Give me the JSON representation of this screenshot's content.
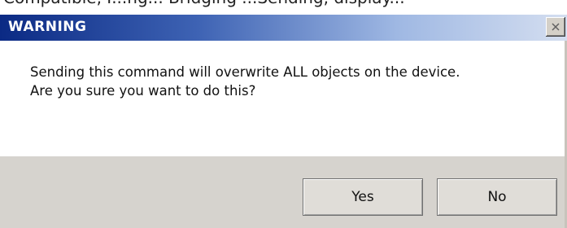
{
  "background_caption": "Compatible, I...ng... Bridging ...Sending, display...",
  "dialog": {
    "title": "WARNING",
    "close_label": "",
    "message_line_1": "Sending this command will overwrite ALL objects on the device.",
    "message_line_2": "Are you sure you want to do this?",
    "buttons": {
      "yes": "Yes",
      "no": "No"
    }
  },
  "colors": {
    "title_gradient_start": "#0b2a84",
    "title_gradient_end": "#d4def0",
    "button_area": "#d6d3ce"
  }
}
